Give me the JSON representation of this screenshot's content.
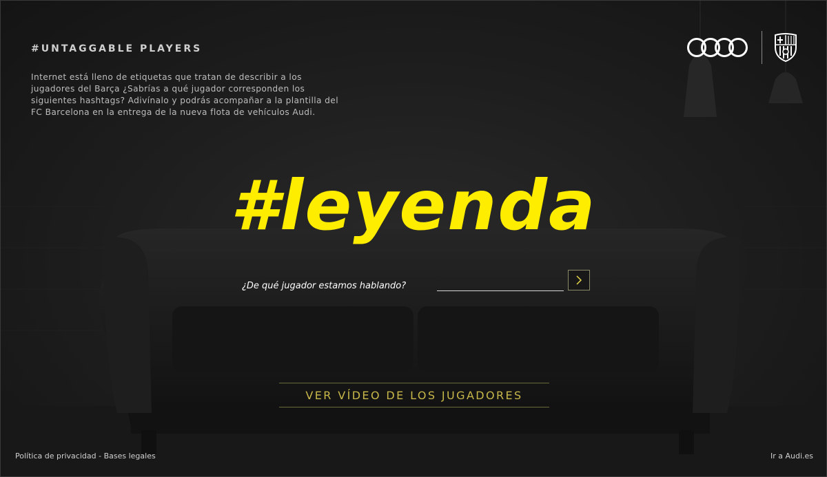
{
  "intro": {
    "title": "#UNTAGGABLE PLAYERS",
    "text": "Internet está lleno de etiquetas que tratan de describir a los jugadores del Barça ¿Sabrías a qué jugador corresponden los siguientes hashtags? Adivínalo y podrás acompañar a la plantilla del FC Barcelona en la entrega de la nueva flota de vehículos Audi."
  },
  "hashtag": "#leyenda",
  "question": {
    "label": "¿De qué jugador estamos hablando?",
    "input_value": "",
    "submit_icon": "chevron-right-icon"
  },
  "video_button": "VER VÍDEO DE LOS JUGADORES",
  "footer": {
    "privacy": "Política de privacidad",
    "separator": " - ",
    "legal": "Bases legales",
    "audi_link": "Ir a Audi.es"
  },
  "brands": {
    "audi_logo_icon": "audi-rings-icon",
    "barca_logo_icon": "fc-barcelona-crest-icon"
  },
  "colors": {
    "accent_yellow": "#ffed00",
    "button_text": "#c8b84a",
    "background": "#1c1c1c"
  }
}
